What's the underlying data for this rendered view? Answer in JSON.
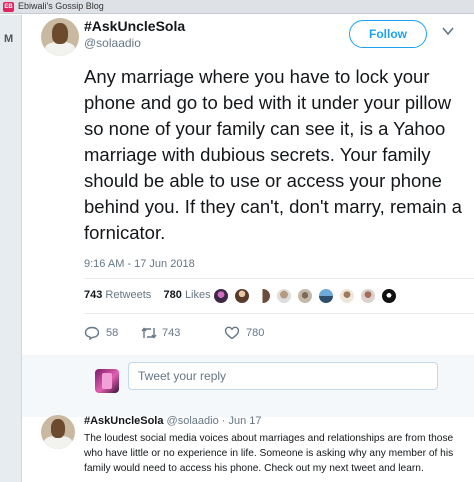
{
  "browser": {
    "tab_title": "Ebiwali's Gossip Blog",
    "favicon_text": "EB"
  },
  "left_strip": {
    "letter": "M"
  },
  "tweet": {
    "author_name": "#AskUncleSola",
    "author_handle": "@solaadio",
    "follow_label": "Follow",
    "text": "Any marriage where you have to lock your phone and go to bed with it under your pillow so none of your family can see it, is a Yahoo marriage with dubious secrets. Your family should be able to use or access your phone behind you. If they can't, don't marry, remain a fornicator.",
    "timestamp": "9:16 AM - 17 Jun 2018",
    "retweets_count": "743",
    "retweets_label": "Retweets",
    "likes_count": "780",
    "likes_label": "Likes",
    "actions": {
      "reply_count": "58",
      "retweet_count": "743",
      "like_count": "780"
    }
  },
  "reply": {
    "placeholder": "Tweet your reply"
  },
  "second_tweet": {
    "author_name": "#AskUncleSola",
    "author_handle": "@solaadio",
    "date": "Jun 17",
    "separator": "·",
    "text": "The loudest social media voices about marriages and relationships are from those who have little or no experience in life. Someone is asking why any member of his family would need to access his phone. Check out my next tweet and learn."
  },
  "colors": {
    "accent": "#1da1f2",
    "text": "#14171a",
    "muted": "#657786",
    "divider": "#e6ecf0",
    "reply_bg": "#f5f8fa"
  },
  "icons": [
    "tab-favicon",
    "caret-down-icon",
    "reply-icon",
    "retweet-icon",
    "heart-icon",
    "liker-avatars"
  ]
}
